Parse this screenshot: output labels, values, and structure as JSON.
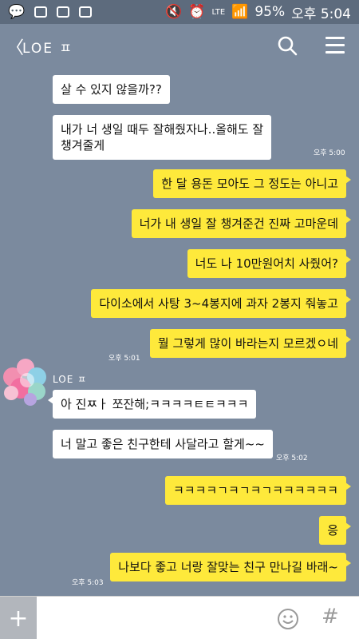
{
  "status_bar": {
    "battery": "95%",
    "time": "오후 5:04",
    "network": "LTE"
  },
  "header": {
    "back_symbol": "〈",
    "title": "LOE ㅍ"
  },
  "messages": [
    {
      "side": "left",
      "text": "살 수 있지 않을까??"
    },
    {
      "side": "left",
      "text": "내가 너 생일 때두 잘해줬자나..올해도 잘\n챙겨줄게"
    },
    {
      "side": "right",
      "text": "한 달 용돈 모아도 그 정도는 아니고"
    },
    {
      "side": "right",
      "text": "너가 내 생일 잘 챙겨준건 진짜 고마운데"
    },
    {
      "side": "right",
      "text": "너도 나 10만원어치 사줬어?"
    },
    {
      "side": "right",
      "text": "다이소에서 사탕 3~4봉지에 과자 2봉지 줘놓고"
    },
    {
      "side": "right",
      "text": "뭘 그렇게 많이 바라는지 모르겠ㅇ네"
    },
    {
      "side": "left",
      "text": "아 진ㅉㅏ 쪼잔해;ㅋㅋㅋㅋㅌㅌㅋㅋㅋ"
    },
    {
      "side": "left",
      "text": "너 말고 좋은 친구한테 사달라고 할게~~"
    },
    {
      "side": "right",
      "text": "ㅋㅋㅋㅋㄱㅋㄱㅋㄱㅋㅋㅋㅋㅋㅋ"
    },
    {
      "side": "right",
      "text": "응"
    },
    {
      "side": "right",
      "text": "나보다 좋고 너랑 잘맞는 친구 만나길 바래~"
    }
  ],
  "timestamps": [
    "오후 5:00",
    "오후 5:01",
    "오후 5:02",
    "오후 5:03"
  ],
  "sender_name": "LOE ㅍ",
  "input": {
    "plus_symbol": "+",
    "hash_symbol": "#",
    "value": ""
  },
  "icons": [
    "back-icon",
    "search-icon",
    "menu-icon",
    "avatar",
    "plus-icon",
    "emoji-icon",
    "hash-icon"
  ],
  "colors": {
    "background": "#7b8a9e",
    "my_bubble": "#fee93b",
    "their_bubble": "#ffffff"
  }
}
